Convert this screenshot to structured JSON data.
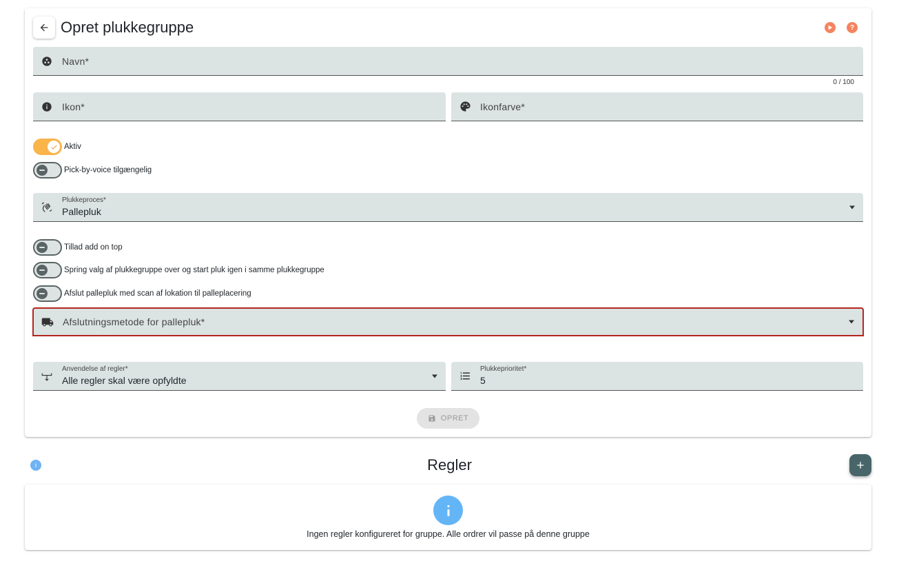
{
  "header": {
    "title": "Opret plukkegruppe",
    "accent_color": "#f4845f"
  },
  "form": {
    "name_field": {
      "label": "Navn*",
      "counter": "0 / 100"
    },
    "icon_field": {
      "label": "Ikon*"
    },
    "icon_color_field": {
      "label": "Ikonfarve*"
    },
    "toggles_top": [
      {
        "label": "Aktiv",
        "on": true
      },
      {
        "label": "Pick-by-voice tilgængelig",
        "on": false
      }
    ],
    "pick_process": {
      "label": "Plukkeproces*",
      "value": "Pallepluk"
    },
    "toggles_mid": [
      {
        "label": "Tillad add on top",
        "on": false
      },
      {
        "label": "Spring valg af plukkegruppe over og start pluk igen i samme plukkegruppe",
        "on": false
      },
      {
        "label": "Afslut pallepluk med scan af lokation til palleplacering",
        "on": false
      }
    ],
    "finish_method": {
      "label": "Afslutningsmetode for pallepluk*"
    },
    "rule_usage": {
      "label": "Anvendelse af regler*",
      "value": "Alle regler skal være opfyldte"
    },
    "priority": {
      "label": "Plukkeprioritet*",
      "value": "5"
    },
    "submit_label": "OPRET"
  },
  "rules": {
    "title": "Regler",
    "empty_text": "Ingen regler konfigureret for gruppe. Alle ordrer vil passe på denne gruppe",
    "info_color": "#64b5f6",
    "fab_color": "#48666a"
  }
}
